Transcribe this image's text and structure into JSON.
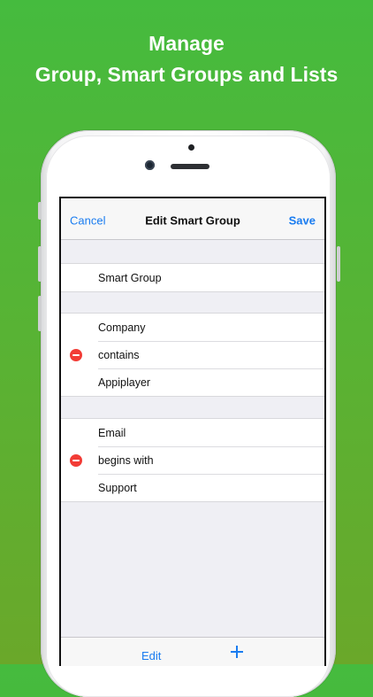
{
  "headline": {
    "line1": "Manage",
    "line2": "Group, Smart Groups and Lists"
  },
  "navbar": {
    "cancel_label": "Cancel",
    "title": "Edit Smart Group",
    "save_label": "Save"
  },
  "name_section": {
    "value": "Smart Group"
  },
  "rules": [
    {
      "field": "Company",
      "operator": "contains",
      "value": "Appiplayer"
    },
    {
      "field": "Email",
      "operator": "begins with",
      "value": "Support"
    }
  ],
  "toolbar": {
    "edit_label": "Edit",
    "add_icon": "plus-icon"
  },
  "colors": {
    "accent": "#1a7cf0",
    "delete": "#f23c36",
    "background_green": "#4fb83a"
  }
}
